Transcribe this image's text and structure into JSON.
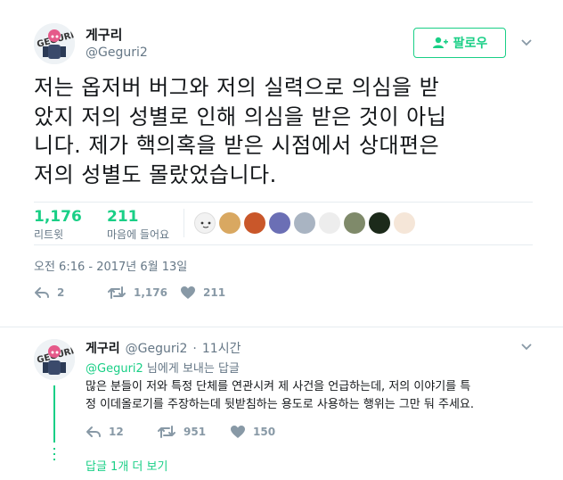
{
  "author": {
    "name": "게구리",
    "handle": "@Geguri2"
  },
  "follow_button": {
    "label": "팔로우"
  },
  "tweet": {
    "lines": [
      "저는 옵저버 버그와 저의 실력으로 의심을 받",
      "았지 저의 성별로 인해 의심을 받은 것이 아닙",
      "니다. 제가 핵의혹을 받은 시점에서 상대편은",
      "저의 성별도 몰랐었습니다."
    ],
    "retweets": {
      "count": "1,176",
      "label": "리트윗"
    },
    "likes": {
      "count": "211",
      "label": "마음에 들어요"
    },
    "timestamp": "오전 6:16 - 2017년 6월 13일",
    "actions": {
      "reply": "2",
      "retweet": "1,176",
      "like": "211"
    }
  },
  "reply": {
    "name": "게구리",
    "handle": "@Geguri2",
    "sep": "·",
    "time": "11시간",
    "to_handle": "@Geguri2",
    "to_suffix": " 님에게 보내는 답글",
    "lines": [
      "많은 분들이 저와 특정 단체를 연관시켜 제 사건을 언급하는데, 저의 이야기를 특",
      "정 이데올로기를 주장하는데 뒷받침하는 용도로 사용하는 행위는 그만 둬 주세요."
    ],
    "actions": {
      "reply": "12",
      "retweet": "951",
      "like": "150"
    },
    "more_replies": "답글 1개 더 보기"
  },
  "colors": {
    "accent": "#19cf86",
    "muted": "#657786",
    "icon": "#8899a6"
  },
  "icons": [
    "follow-person-icon",
    "chevron-down-icon",
    "reply-icon",
    "retweet-icon",
    "heart-icon"
  ]
}
